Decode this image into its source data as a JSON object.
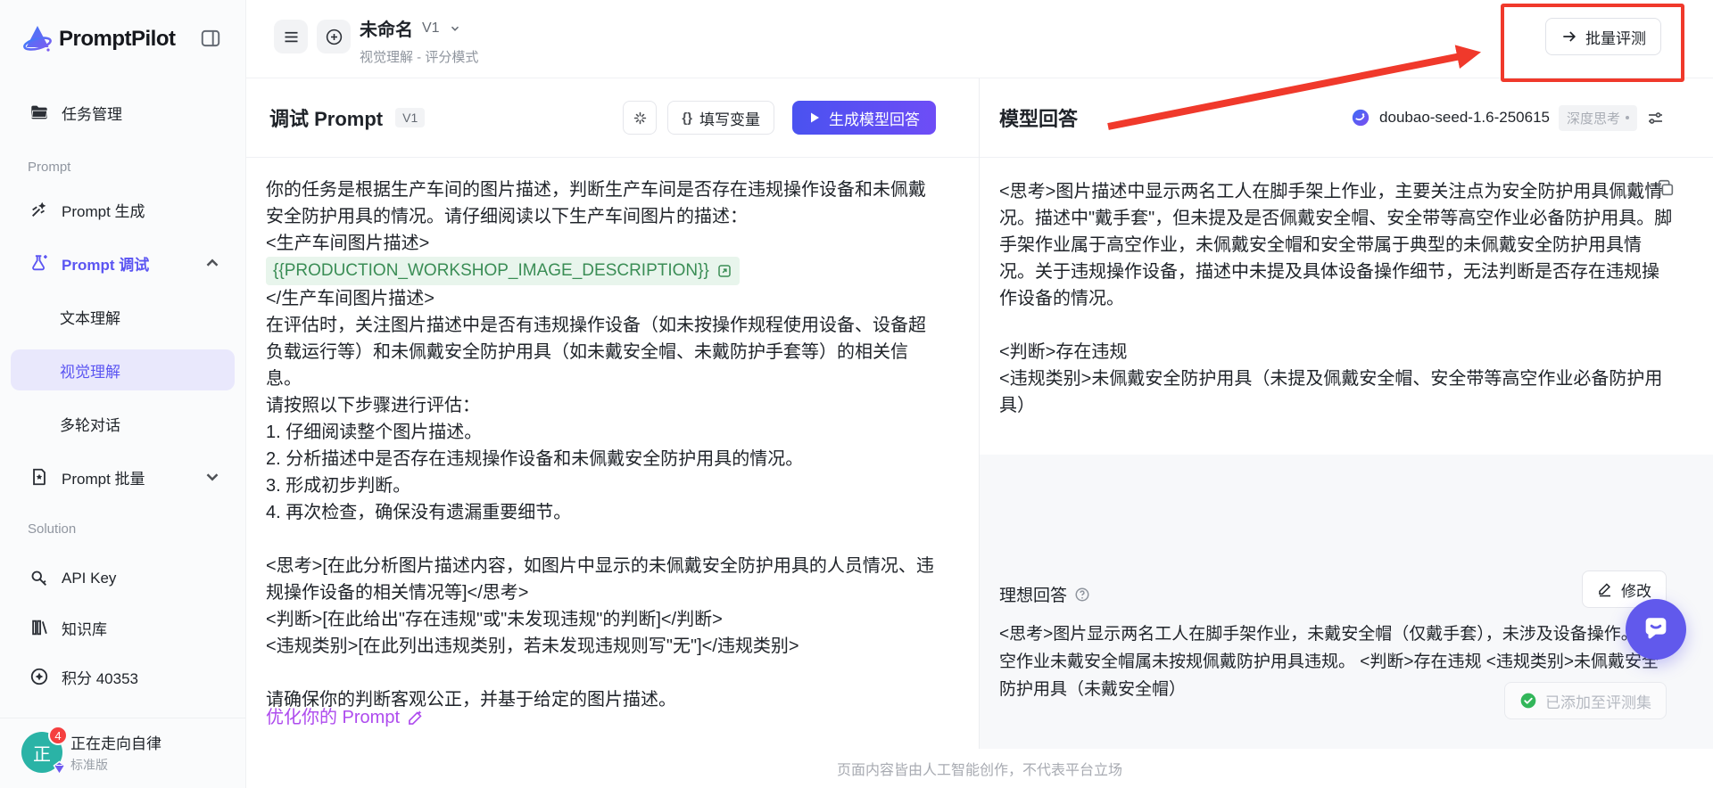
{
  "app": {
    "name": "PromptPilot"
  },
  "sidebar": {
    "sections": {
      "prompt": "Prompt",
      "solution": "Solution"
    },
    "items": [
      {
        "label": "任务管理"
      },
      {
        "label": "Prompt 生成"
      },
      {
        "label": "Prompt 调试"
      },
      {
        "label": "文本理解"
      },
      {
        "label": "视觉理解"
      },
      {
        "label": "多轮对话"
      },
      {
        "label": "Prompt 批量"
      },
      {
        "label": "API Key"
      },
      {
        "label": "知识库"
      },
      {
        "label": "积分 40353"
      }
    ],
    "user": {
      "name": "正在走向自律",
      "plan": "标准版",
      "notifications": "4",
      "avatar_char": "正"
    }
  },
  "header": {
    "title": "未命名",
    "version": "V1",
    "subtitle": "视觉理解 - 评分模式",
    "batch_eval_label": "批量评测"
  },
  "icons": {
    "braces": "{}"
  },
  "prompt_panel": {
    "title": "调试 Prompt",
    "version_badge": "V1",
    "fill_variables_label": "填写变量",
    "generate_label": "生成模型回答",
    "body_before": "你的任务是根据生产车间的图片描述，判断生产车间是否存在违规操作设备和未佩戴安全防护用具的情况。请仔细阅读以下生产车间图片的描述：\n<生产车间图片描述>\n",
    "variable": "{{PRODUCTION_WORKSHOP_IMAGE_DESCRIPTION}}",
    "body_after": "\n</生产车间图片描述>\n在评估时，关注图片描述中是否有违规操作设备（如未按操作规程使用设备、设备超负载运行等）和未佩戴安全防护用具（如未戴安全帽、未戴防护手套等）的相关信息。\n请按照以下步骤进行评估：\n1. 仔细阅读整个图片描述。\n2. 分析描述中是否存在违规操作设备和未佩戴安全防护用具的情况。\n3. 形成初步判断。\n4. 再次检查，确保没有遗漏重要细节。\n\n<思考>[在此分析图片描述内容，如图片中显示的未佩戴安全防护用具的人员情况、违规操作设备的相关情况等]</思考>\n<判断>[在此给出\"存在违规\"或\"未发现违规\"的判断]</判断>\n<违规类别>[在此列出违规类别，若未发现违规则写\"无\"]</违规类别>\n\n请确保你的判断客观公正，并基于给定的图片描述。",
    "optimize_link": "优化你的 Prompt"
  },
  "answer_panel": {
    "title": "模型回答",
    "model_name": "doubao-seed-1.6-250615",
    "mode_badge": "深度思考",
    "response": "<思考>图片描述中显示两名工人在脚手架上作业，主要关注点为安全防护用具佩戴情况。描述中\"戴手套\"，但未提及是否佩戴安全帽、安全带等高空作业必备防护用具。脚手架作业属于高空作业，未佩戴安全帽和安全带属于典型的未佩戴安全防护用具情况。关于违规操作设备，描述中未提及具体设备操作细节，无法判断是否存在违规操作设备的情况。\n\n<判断>存在违规\n<违规类别>未佩戴安全防护用具（未提及佩戴安全帽、安全带等高空作业必备防护用具）",
    "ideal": {
      "label": "理想回答",
      "edit_label": "修改",
      "text": "<思考>图片显示两名工人在脚手架作业，未戴安全帽（仅戴手套），未涉及设备操作。高空作业未戴安全帽属未按规佩戴防护用具违规。 <判断>存在违规 <违规类别>未佩戴安全防护用具（未戴安全帽）",
      "added_label": "已添加至评测集"
    }
  },
  "footer": {
    "disclaimer": "页面内容皆由人工智能创作，不代表平台立场"
  },
  "colors": {
    "accent": "#5b55f2",
    "cta_gradient_start": "#4a52f0",
    "cta_gradient_end": "#6e4df6",
    "annotation_red": "#f0392b",
    "variable_green": "#3a8d55",
    "variable_bg": "#e8f5ec",
    "optimize_purple": "#ae4bee",
    "fab_indigo": "#6159ec",
    "check_green": "#32b65a",
    "avatar_teal": "#2ab3a6"
  }
}
